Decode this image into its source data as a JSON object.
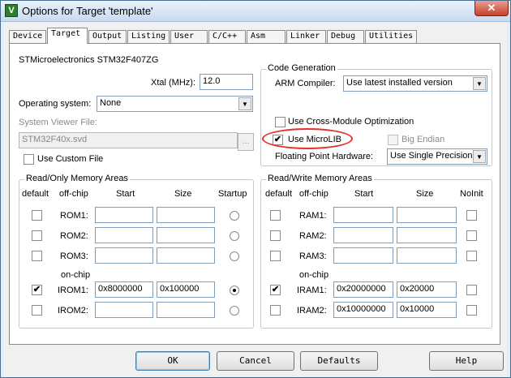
{
  "window": {
    "title": "Options for Target 'template'",
    "close_glyph": "✕",
    "icon_glyph": "V"
  },
  "tabs": [
    "Device",
    "Target",
    "Output",
    "Listing",
    "User",
    "C/C++",
    "Asm",
    "Linker",
    "Debug",
    "Utilities"
  ],
  "active_tab": "Target",
  "device_name": "STMicroelectronics STM32F407ZG",
  "xtal": {
    "label": "Xtal (MHz):",
    "value": "12.0"
  },
  "os": {
    "label": "Operating system:",
    "value": "None"
  },
  "svd": {
    "label": "System Viewer File:",
    "value": "STM32F40x.svd",
    "browse": "..."
  },
  "custom_file": {
    "label": "Use Custom File",
    "checked": false
  },
  "codegen": {
    "title": "Code Generation",
    "compiler_label": "ARM Compiler:",
    "compiler_value": "Use latest installed version",
    "cross_module": {
      "label": "Use Cross-Module Optimization",
      "checked": false
    },
    "microlib": {
      "label": "Use MicroLIB",
      "checked": true,
      "check_glyph": "✔"
    },
    "big_endian": {
      "label": "Big Endian",
      "checked": false
    },
    "fp_label": "Floating Point Hardware:",
    "fp_value": "Use Single Precision"
  },
  "rom": {
    "title": "Read/Only Memory Areas",
    "headers": {
      "default": "default",
      "offchip": "off-chip",
      "start": "Start",
      "size": "Size",
      "startup": "Startup"
    },
    "onchip_label": "on-chip",
    "rows": [
      {
        "name": "ROM1:",
        "start": "",
        "size": "",
        "default": false,
        "startup": false
      },
      {
        "name": "ROM2:",
        "start": "",
        "size": "",
        "default": false,
        "startup": false
      },
      {
        "name": "ROM3:",
        "start": "",
        "size": "",
        "default": false,
        "startup": false
      },
      {
        "name": "IROM1:",
        "start": "0x8000000",
        "size": "0x100000",
        "default": true,
        "startup": true
      },
      {
        "name": "IROM2:",
        "start": "",
        "size": "",
        "default": false,
        "startup": false
      }
    ]
  },
  "ram": {
    "title": "Read/Write Memory Areas",
    "headers": {
      "default": "default",
      "offchip": "off-chip",
      "start": "Start",
      "size": "Size",
      "noinit": "NoInit"
    },
    "onchip_label": "on-chip",
    "rows": [
      {
        "name": "RAM1:",
        "start": "",
        "size": "",
        "default": false,
        "noinit": false
      },
      {
        "name": "RAM2:",
        "start": "",
        "size": "",
        "default": false,
        "noinit": false
      },
      {
        "name": "RAM3:",
        "start": "",
        "size": "",
        "default": false,
        "noinit": false
      },
      {
        "name": "IRAM1:",
        "start": "0x20000000",
        "size": "0x20000",
        "default": true,
        "noinit": false
      },
      {
        "name": "IRAM2:",
        "start": "0x10000000",
        "size": "0x10000",
        "default": false,
        "noinit": false
      }
    ]
  },
  "buttons": {
    "ok": "OK",
    "cancel": "Cancel",
    "defaults": "Defaults",
    "help": "Help"
  },
  "colors": {
    "highlight": "#e53030",
    "title_gradient": "#c9daf0"
  }
}
